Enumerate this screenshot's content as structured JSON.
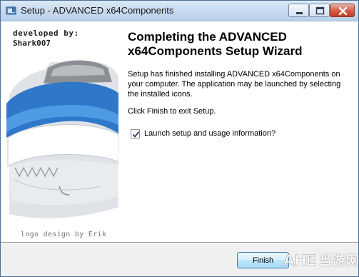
{
  "window": {
    "title": "Setup - ADVANCED x64Components",
    "minimize_icon": "minimize-icon",
    "maximize_icon": "maximize-icon",
    "close_icon": "close-icon"
  },
  "sidebar": {
    "developed_by_label": "developed by:",
    "developer_name": "Shark007",
    "logo_icon": "shark-logo",
    "logo_credit": "logo design by Erik"
  },
  "main": {
    "heading": "Completing the ADVANCED x64Components Setup Wizard",
    "body_text": "Setup has finished installing ADVANCED x64Components on your computer. The application may be launched by selecting the installed icons.",
    "exit_text": "Click Finish to exit Setup.",
    "launch_checkbox": {
      "label": "Launch setup and usage information?",
      "checked": true
    }
  },
  "footer": {
    "finish_label": "Finish"
  },
  "watermark": {
    "brand_mark": "AHE",
    "site_text": "当游网"
  }
}
